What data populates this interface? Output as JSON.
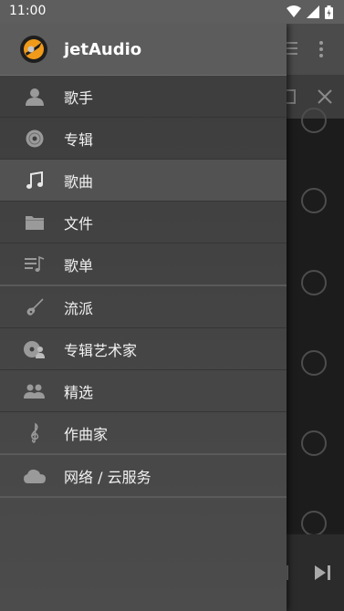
{
  "status_bar": {
    "time": "11:00"
  },
  "app": {
    "name": "jetAudio"
  },
  "menu": [
    {
      "label": "歌手",
      "icon": "person-icon"
    },
    {
      "label": "专辑",
      "icon": "disc-icon"
    },
    {
      "label": "歌曲",
      "icon": "music-note-icon",
      "active": true
    },
    {
      "label": "文件",
      "icon": "folder-icon"
    },
    {
      "label": "歌单",
      "icon": "playlist-icon"
    },
    {
      "label": "流派",
      "icon": "guitar-icon"
    },
    {
      "label": "专辑艺术家",
      "icon": "album-artist-icon"
    },
    {
      "label": "精选",
      "icon": "group-icon"
    },
    {
      "label": "作曲家",
      "icon": "treble-clef-icon"
    },
    {
      "label": "网络 / 云服务",
      "icon": "cloud-icon"
    }
  ]
}
